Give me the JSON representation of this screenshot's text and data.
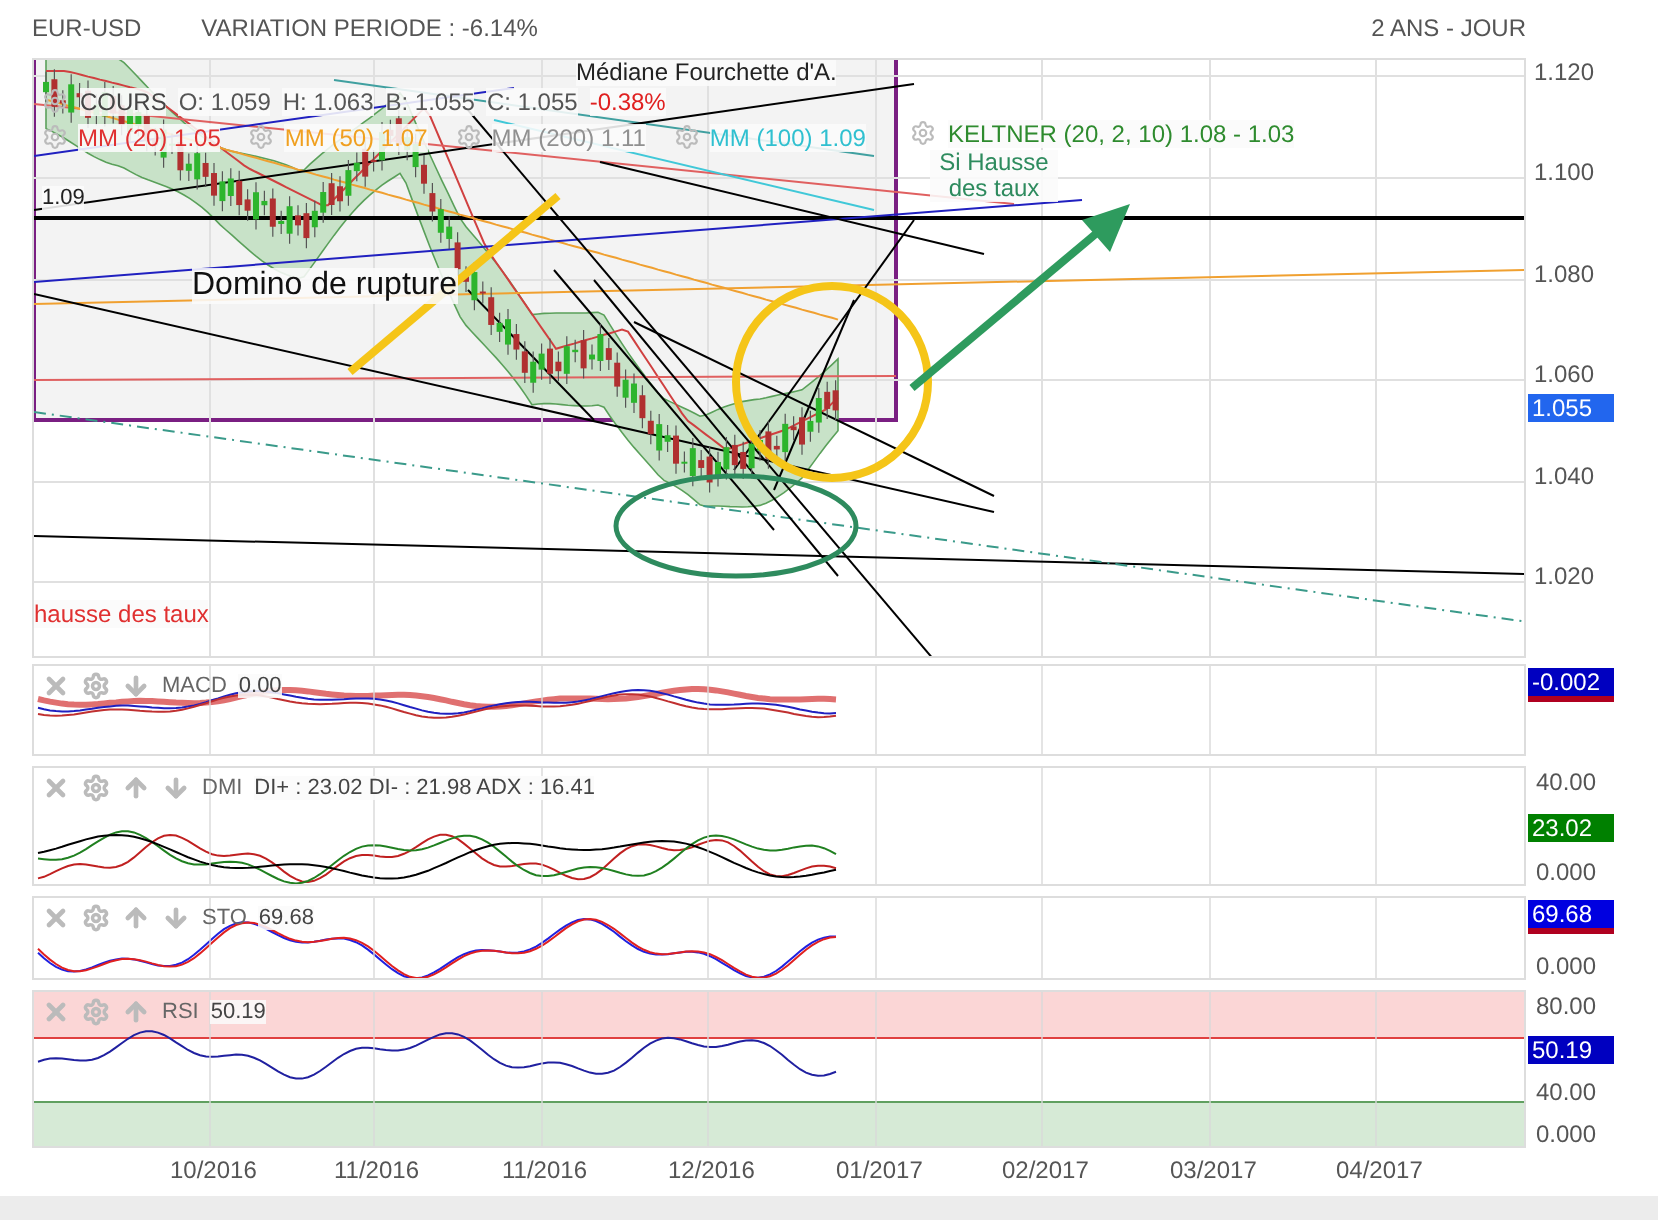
{
  "header": {
    "symbol": "EUR-USD",
    "variation": "VARIATION PERIODE : -6.14%",
    "period": "2 ANS - JOUR"
  },
  "main_chart": {
    "cut_title": "Médiane Fourchette d'A.",
    "quote": [
      {
        "kind": "name",
        "text": "COURS"
      },
      {
        "kind": "plain",
        "text": "O: 1.059"
      },
      {
        "kind": "plain",
        "text": "H: 1.063"
      },
      {
        "kind": "plain",
        "text": "B: 1.055"
      },
      {
        "kind": "plain",
        "text": "C: 1.055"
      },
      {
        "kind": "change",
        "text": "-0.38%"
      }
    ],
    "indicators": [
      {
        "label": "MM (20)",
        "value": "1.05",
        "color": "#e03030"
      },
      {
        "label": "MM (50)",
        "value": "1.07",
        "color": "#f0a020"
      },
      {
        "label": "MM (200)",
        "value": "1.11",
        "color": "#909090"
      },
      {
        "label": "MM (100)",
        "value": "1.09",
        "color": "#30c0d0"
      },
      {
        "label": "KELTNER (20, 2, 10)",
        "value": "1.08 - 1.03",
        "color": "#2e8b2e"
      }
    ],
    "level_label": "1.09",
    "note": "Domino de rupture",
    "green_note": "Si Hausse des taux",
    "red_note": "hausse des taux",
    "y_ticks": [
      "1.120",
      "1.100",
      "1.080",
      "1.060",
      "1.040",
      "1.020"
    ],
    "price_badge": "1.055"
  },
  "panels": [
    {
      "kind": "macd",
      "title": "MACD",
      "value": "0.00",
      "move_up": false,
      "move_down": true,
      "axis": [
        {
          "kind": "badge",
          "text": "-0.002",
          "color": "#0000c0",
          "underline": true
        }
      ]
    },
    {
      "kind": "dmi",
      "title": "DMI",
      "value": "DI+ : 23.02 DI- : 21.98 ADX : 16.41",
      "move_up": true,
      "move_down": true,
      "axis": [
        {
          "kind": "tick",
          "text": "40.00"
        },
        {
          "kind": "badge",
          "text": "23.02",
          "color": "#008000",
          "underline": false
        },
        {
          "kind": "tick",
          "text": "0.000"
        }
      ]
    },
    {
      "kind": "sto",
      "title": "STO",
      "value": "69.68",
      "move_up": true,
      "move_down": true,
      "axis": [
        {
          "kind": "badge",
          "text": "69.68",
          "color": "#0000e0",
          "underline": true
        },
        {
          "kind": "tick",
          "text": "0.000"
        }
      ]
    },
    {
      "kind": "rsi",
      "title": "RSI",
      "value": "50.19",
      "move_up": true,
      "move_down": false,
      "axis": [
        {
          "kind": "tick",
          "text": "80.00"
        },
        {
          "kind": "badge",
          "text": "50.19",
          "color": "#0000c0",
          "underline": false
        },
        {
          "kind": "tick",
          "text": "40.00"
        },
        {
          "kind": "tick",
          "text": "0.000"
        }
      ]
    }
  ],
  "x_ticks": [
    "10/2016",
    "11/2016",
    "11/2016",
    "12/2016",
    "01/2017",
    "02/2017",
    "03/2017",
    "04/2017"
  ]
}
